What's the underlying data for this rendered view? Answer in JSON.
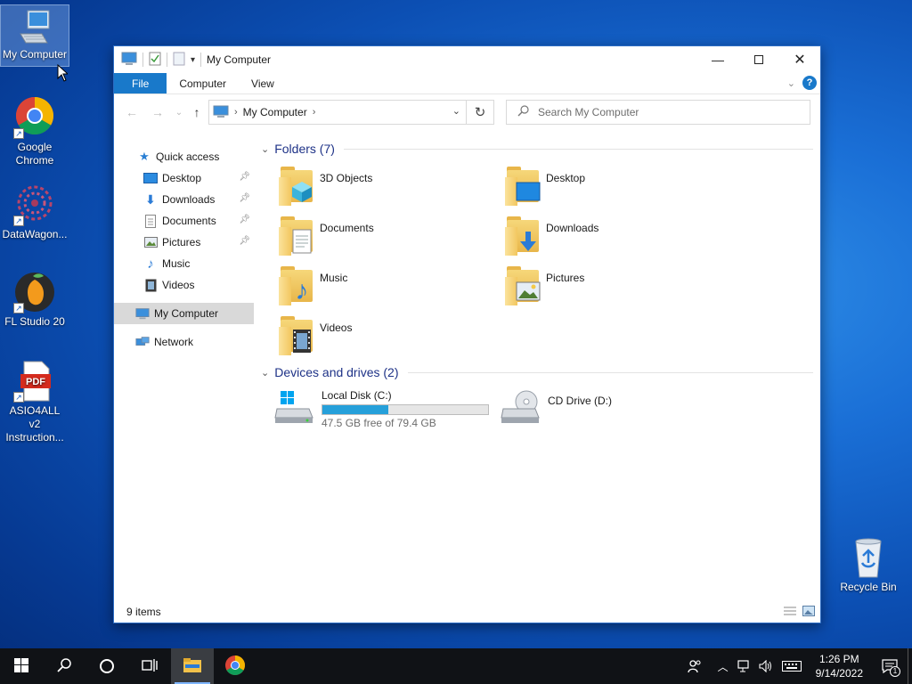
{
  "desktop": {
    "icons": [
      {
        "label": "My Computer"
      },
      {
        "label": "Google Chrome"
      },
      {
        "label": "DataWagon..."
      },
      {
        "label": "FL Studio 20"
      },
      {
        "label": "ASIO4ALL v2 Instruction..."
      },
      {
        "label": "Recycle Bin"
      }
    ]
  },
  "window": {
    "title": "My Computer",
    "tabs": {
      "file": "File",
      "computer": "Computer",
      "view": "View"
    },
    "help": "?",
    "address": {
      "location": "My Computer"
    },
    "search": {
      "placeholder": "Search My Computer"
    },
    "nav": {
      "quick_access": "Quick access",
      "items": [
        "Desktop",
        "Downloads",
        "Documents",
        "Pictures",
        "Music",
        "Videos"
      ],
      "my_computer": "My Computer",
      "network": "Network"
    },
    "folders_header": "Folders (7)",
    "folders": [
      "3D Objects",
      "Desktop",
      "Documents",
      "Downloads",
      "Music",
      "Pictures",
      "Videos"
    ],
    "devices_header": "Devices and drives (2)",
    "drives": [
      {
        "name": "Local Disk (C:)",
        "free": "47.5 GB free of 79.4 GB",
        "used_fraction": 0.4
      },
      {
        "name": "CD Drive (D:)"
      }
    ],
    "status": "9 items"
  },
  "taskbar": {
    "time": "1:26 PM",
    "date": "9/14/2022",
    "notification_count": "1"
  },
  "colors": {
    "accent": "#1979ca",
    "drive_fill": "#26a0da",
    "header_text": "#1e3287"
  }
}
